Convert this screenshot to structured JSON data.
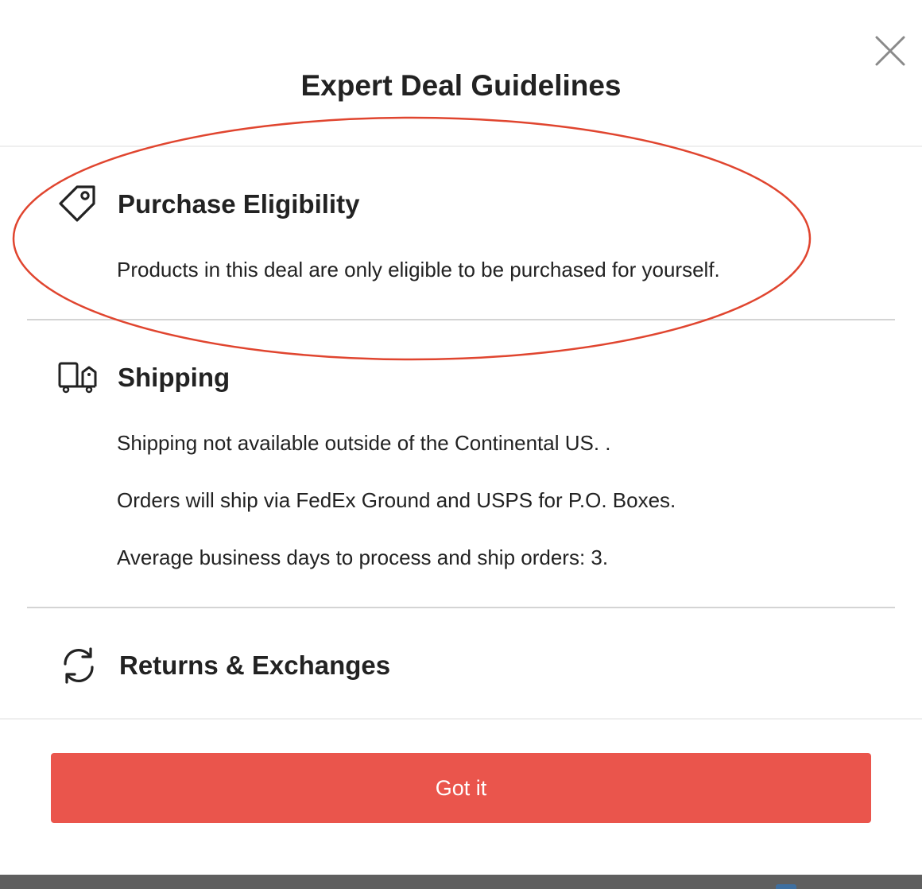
{
  "modal": {
    "title": "Expert Deal Guidelines",
    "close_icon": "close-icon"
  },
  "sections": [
    {
      "icon": "price-tag-icon",
      "heading": "Purchase Eligibility",
      "lines": [
        "Products in this deal are only eligible to be purchased for yourself."
      ]
    },
    {
      "icon": "delivery-truck-icon",
      "heading": "Shipping",
      "lines": [
        "Shipping not available outside of the Continental US. .",
        "Orders will ship via FedEx Ground and USPS for P.O. Boxes.",
        "Average business days to process and ship orders: 3."
      ]
    },
    {
      "icon": "refresh-arrows-icon",
      "heading": "Returns & Exchanges",
      "lines": []
    }
  ],
  "footer": {
    "button_label": "Got it"
  },
  "colors": {
    "accent": "#ea554c",
    "annotation": "#e0452f",
    "text": "#222222",
    "divider": "#d4d4d4"
  }
}
